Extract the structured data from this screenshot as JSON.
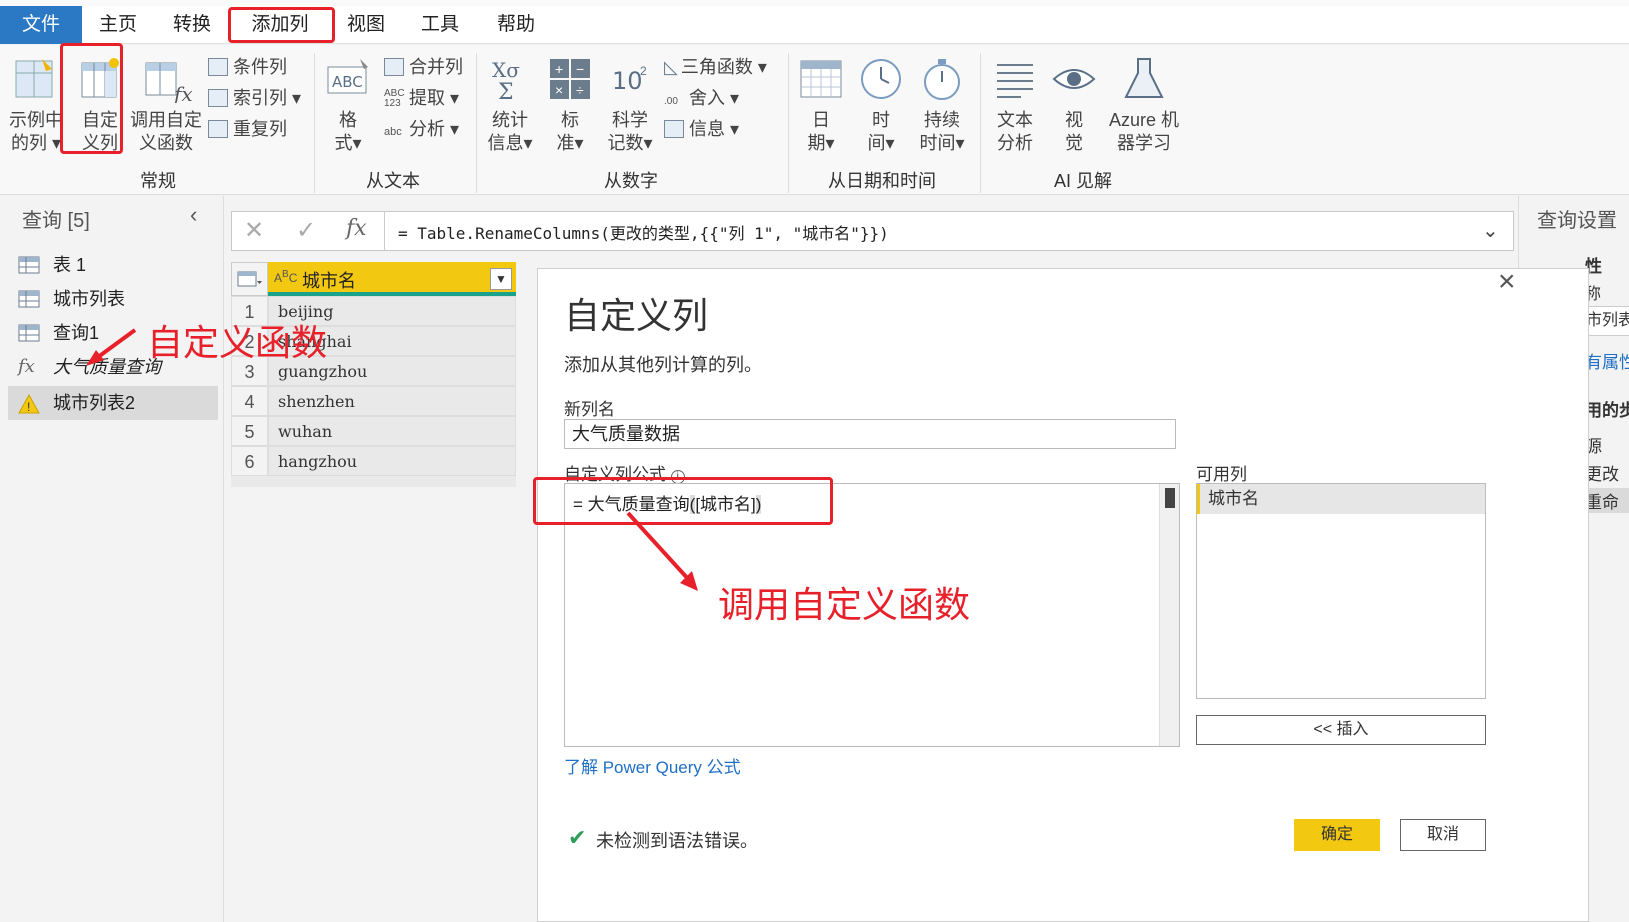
{
  "menu": {
    "file": "文件",
    "home": "主页",
    "transform": "转换",
    "add_column": "添加列",
    "view": "视图",
    "tools": "工具",
    "help": "帮助"
  },
  "ribbon": {
    "example_col": [
      "示例中",
      "的列"
    ],
    "custom_col": [
      "自定",
      "义列"
    ],
    "invoke_fn": [
      "调用自定",
      "义函数"
    ],
    "conditional": "条件列",
    "index": "索引列",
    "duplicate": "重复列",
    "format": [
      "格",
      "式"
    ],
    "merge": "合并列",
    "extract": "提取",
    "parse": "分析",
    "stats": [
      "统计",
      "信息"
    ],
    "standard": [
      "标",
      "准"
    ],
    "scientific": [
      "科学",
      "记数"
    ],
    "trig": "三角函数",
    "rounding": "舍入",
    "info": "信息",
    "date": [
      "日",
      "期"
    ],
    "time": [
      "时",
      "间"
    ],
    "duration": [
      "持续",
      "时间"
    ],
    "text_analytics": [
      "文本",
      "分析"
    ],
    "vision": [
      "视",
      "觉"
    ],
    "azure_ml": [
      "Azure 机",
      "器学习"
    ],
    "groups": {
      "general": "常规",
      "from_text": "从文本",
      "from_number": "从数字",
      "from_datetime": "从日期和时间",
      "ai": "AI 见解"
    }
  },
  "queries": {
    "title": "查询 [5]",
    "items": [
      {
        "name": "表 1",
        "type": "table"
      },
      {
        "name": "城市列表",
        "type": "table"
      },
      {
        "name": "查询1",
        "type": "table"
      },
      {
        "name": "大气质量查询",
        "type": "function"
      },
      {
        "name": "城市列表2",
        "type": "warning"
      }
    ]
  },
  "formula_bar": {
    "text": "= Table.RenameColumns(更改的类型,{{\"列 1\", \"城市名\"}})"
  },
  "grid": {
    "column": "城市名",
    "rows": [
      {
        "n": "1",
        "v": "beijing"
      },
      {
        "n": "2",
        "v": "shanghai"
      },
      {
        "n": "3",
        "v": "guangzhou"
      },
      {
        "n": "4",
        "v": "shenzhen"
      },
      {
        "n": "5",
        "v": "wuhan"
      },
      {
        "n": "6",
        "v": "hangzhou"
      }
    ]
  },
  "dialog": {
    "title": "自定义列",
    "subtitle": "添加从其他列计算的列。",
    "new_col_label": "新列名",
    "new_col_value": "大气质量数据",
    "formula_label": "自定义列公式",
    "formula_prefix": "= 大气质量查询",
    "formula_open": "(",
    "formula_arg": "[城市名]",
    "formula_close": ")",
    "available_label": "可用列",
    "available_items": [
      "城市名"
    ],
    "insert": "<< 插入",
    "learn_link": "了解 Power Query 公式",
    "status": "未检测到语法错误。",
    "ok": "确定",
    "cancel": "取消"
  },
  "settings": {
    "title": "查询设置",
    "fragments": [
      "性",
      "称",
      "市列表",
      "有属性",
      "用的步",
      "源",
      "更改",
      "重命"
    ]
  },
  "annotations": {
    "define_fn": "自定义函数",
    "invoke_fn": "调用自定义函数"
  },
  "colors": {
    "accent": "#2b78c5",
    "red": "#e8202a",
    "header_yellow": "#f2c811",
    "ok_yellow": "#f2c811",
    "link": "#1f6fc5"
  }
}
